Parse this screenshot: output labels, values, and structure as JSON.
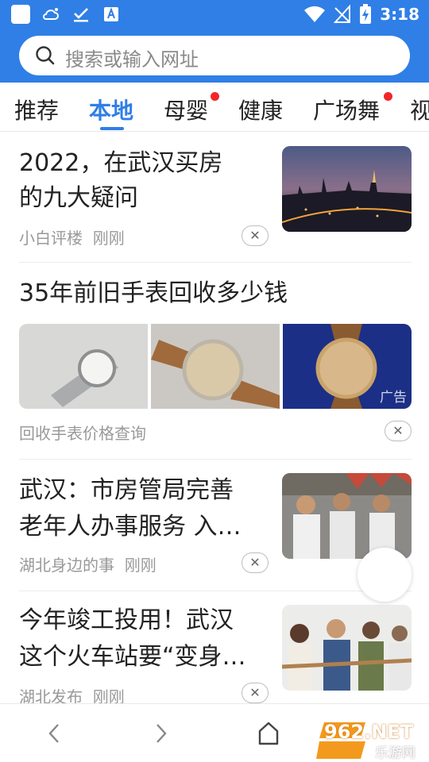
{
  "status_bar": {
    "time": "3:18"
  },
  "search": {
    "placeholder": "搜索或输入网址"
  },
  "tabs": [
    {
      "label": "推荐"
    },
    {
      "label": "本地"
    },
    {
      "label": "母婴"
    },
    {
      "label": "健康"
    },
    {
      "label": "广场舞"
    },
    {
      "label": "视"
    }
  ],
  "feed": [
    {
      "title_line1": "2022，在武汉买房",
      "title_line2": "的九大疑问",
      "source": "小白评楼",
      "time": "刚刚"
    },
    {
      "title": "35年前旧手表回收多少钱",
      "source": "回收手表价格查询",
      "ad_label": "广告"
    },
    {
      "title_line1": "武汉：市房管局完善",
      "title_line2": "老年人办事服务 入…",
      "source": "湖北身边的事",
      "time": "刚刚"
    },
    {
      "title_line1": "今年竣工投用！武汉",
      "title_line2": "这个火车站要“变身…",
      "source": "湖北发布",
      "time": "刚刚"
    }
  ],
  "colors": {
    "accent": "#2f7fe6",
    "badge": "#f2262a"
  },
  "watermark": {
    "text": "962.NET",
    "sub": "乐游网"
  }
}
